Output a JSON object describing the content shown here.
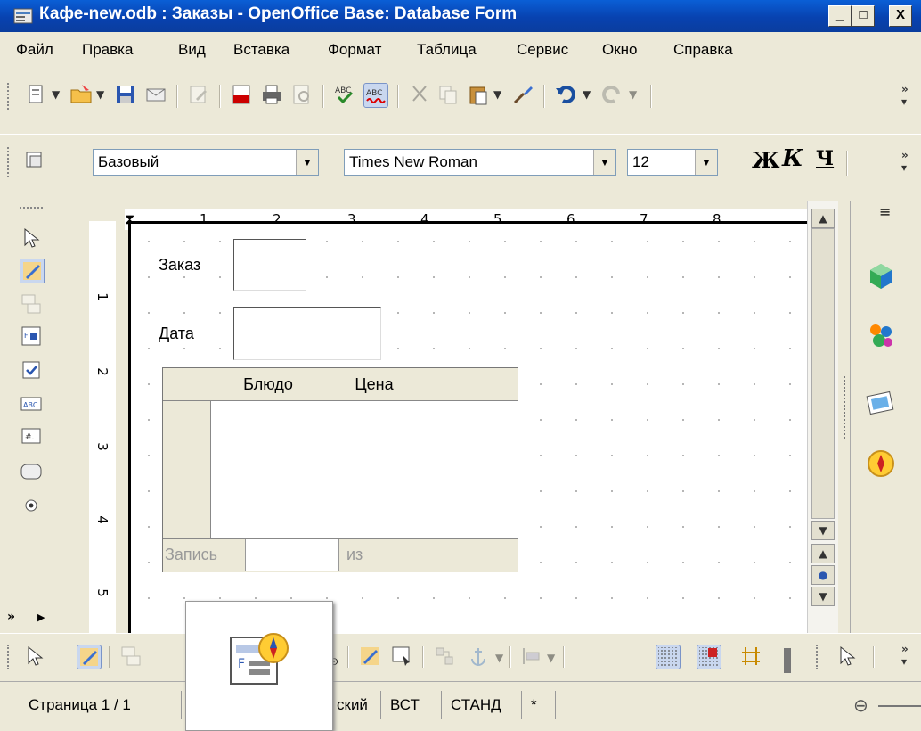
{
  "window": {
    "title": "Кафе-new.odb : Заказы - OpenOffice Base: Database Form",
    "minimize": "_",
    "maximize": "□",
    "close": "X"
  },
  "menu": [
    "Файл",
    "Правка",
    "Вид",
    "Вставка",
    "Формат",
    "Таблица",
    "Сервис",
    "Окно",
    "Справка"
  ],
  "formatting": {
    "style": "Базовый",
    "font": "Times New Roman",
    "size": "12",
    "bold": "Ж",
    "italic": "К",
    "underline": "Ч"
  },
  "ruler": {
    "h_marks": [
      "1",
      "2",
      "3",
      "4",
      "5",
      "6",
      "7",
      "8"
    ],
    "v_marks": [
      "1",
      "2",
      "3",
      "4",
      "5"
    ]
  },
  "form": {
    "order_label": "Заказ",
    "date_label": "Дата",
    "grid": {
      "columns": [
        "Блюдо",
        "Цена"
      ],
      "nav_record": "Запись",
      "nav_of": "из"
    }
  },
  "status": {
    "page": "Страница 1 / 1",
    "lang": "ский",
    "insert": "ВСТ",
    "mode": "СТАНД",
    "modified": "*"
  },
  "colors": {
    "titlebar": "#0842b0",
    "accent": "#ffcc33"
  },
  "icons": [
    "new-document-icon",
    "open-folder-icon",
    "save-icon",
    "email-icon",
    "edit-icon",
    "pdf-icon",
    "print-icon",
    "print-preview-icon",
    "spellcheck-icon",
    "autospell-icon",
    "cut-icon",
    "copy-icon",
    "paste-icon",
    "clone-format-icon",
    "undo-icon",
    "redo-icon"
  ]
}
